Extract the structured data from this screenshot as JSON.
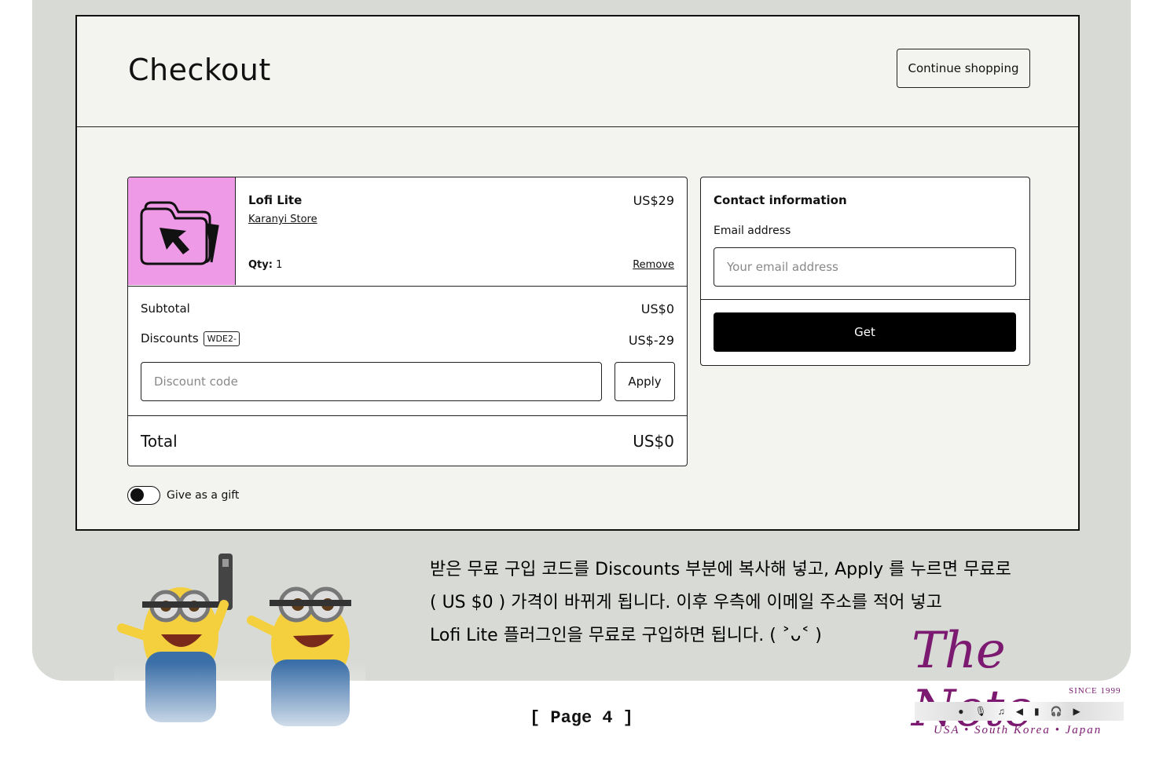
{
  "header": {
    "title": "Checkout",
    "continue_label": "Continue shopping"
  },
  "product": {
    "name": "Lofi Lite",
    "store": "Karanyi Store",
    "price": "US$29",
    "qty_label": "Qty:",
    "qty_value": "1",
    "remove_label": "Remove",
    "thumbnail_icon": "folder-cursor-icon",
    "thumbnail_color": "#ef9ae6"
  },
  "summary": {
    "subtotal_label": "Subtotal",
    "subtotal_value": "US$0",
    "discounts_label": "Discounts",
    "discount_tag": "WDE2-",
    "discounts_value": "US$-29",
    "discount_placeholder": "Discount code",
    "apply_label": "Apply",
    "total_label": "Total",
    "total_value": "US$0"
  },
  "gift": {
    "label": "Give as a gift"
  },
  "contact": {
    "title": "Contact information",
    "email_label": "Email address",
    "email_placeholder": "Your email address",
    "get_label": "Get"
  },
  "note": {
    "line1": "받은 무료 구입 코드를 Discounts 부분에 복사해 넣고, Apply 를 누르면 무료로",
    "line2": "( US $0 ) 가격이 바뀌게 됩니다. 이후 우측에 이메일 주소를 적어 넣고",
    "line3": "Lofi Lite 플러그인을 무료로 구입하면 됩니다. ( ˃ᴗ˂ )"
  },
  "page": {
    "label": "[ Page 4 ]"
  },
  "logo": {
    "script": "The Note",
    "since": "SINCE 1999",
    "locations": "USA • South Korea • Japan"
  }
}
